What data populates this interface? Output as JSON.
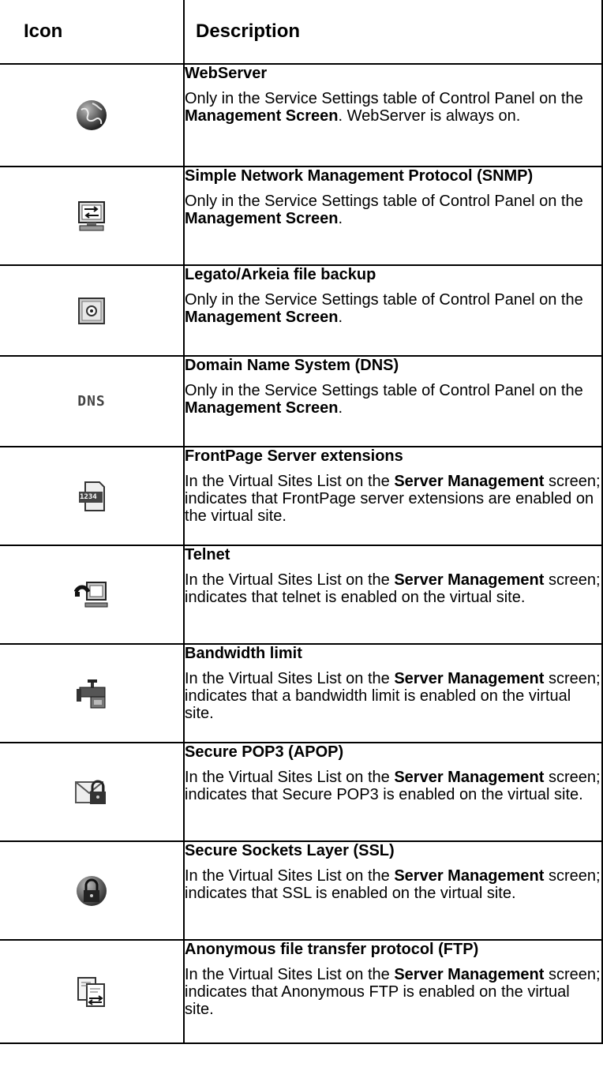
{
  "header": {
    "icon_col": "Icon",
    "desc_col": "Description"
  },
  "rows": [
    {
      "icon": "globe-icon",
      "title": "WebServer",
      "d1": "Only in the Service Settings table of Control Panel on the ",
      "b1": "Management Screen",
      "d2": ".  WebServer is always on.",
      "b2": "",
      "d3": ""
    },
    {
      "icon": "network-monitor-icon",
      "title": "Simple Network Management Protocol (SNMP)",
      "d1": "Only in the Service Settings table of Control Panel on the ",
      "b1": "Management Screen",
      "d2": ".",
      "b2": "",
      "d3": ""
    },
    {
      "icon": "safe-icon",
      "title": "Legato/Arkeia file backup",
      "d1": "Only in the Service Settings table of Control Panel on the ",
      "b1": "Management Screen",
      "d2": ".",
      "b2": "",
      "d3": ""
    },
    {
      "icon": "dns-icon",
      "icon_text": "DNS",
      "title": "Domain Name System (DNS)",
      "d1": "Only in the Service Settings table of Control Panel on the ",
      "b1": "Management Screen",
      "d2": ".",
      "b2": "",
      "d3": ""
    },
    {
      "icon": "frontpage-icon",
      "icon_text": "1234",
      "title": "FrontPage Server extensions",
      "d1": "In the Virtual Sites List on the ",
      "b1": "Server Management",
      "d2": " screen; indicates that FrontPage server extensions are enabled on the virtual site.",
      "b2": "",
      "d3": ""
    },
    {
      "icon": "telnet-icon",
      "title": "Telnet",
      "d1": "In the Virtual Sites List on the ",
      "b1": "Server Management",
      "d2": " screen; indicates that telnet is enabled on the virtual site.",
      "b2": "",
      "d3": ""
    },
    {
      "icon": "faucet-icon",
      "title": "Bandwidth limit",
      "d1": "In the Virtual Sites List on the ",
      "b1": "Server Management",
      "d2": " screen; indicates that a bandwidth limit is enabled on the virtual site.",
      "b2": "",
      "d3": ""
    },
    {
      "icon": "envelope-lock-icon",
      "title": "Secure POP3 (APOP)",
      "d1": "In the Virtual Sites List on the ",
      "b1": "Server Management",
      "d2": " screen; indicates that Secure POP3 is enabled on the virtual site.",
      "b2": "",
      "d3": ""
    },
    {
      "icon": "globe-lock-icon",
      "title": "Secure Sockets Layer (SSL)",
      "d1": "In the Virtual Sites List on the ",
      "b1": "Server Management",
      "d2": " screen; indicates that SSL is enabled on the virtual site.",
      "b2": "",
      "d3": ""
    },
    {
      "icon": "file-transfer-icon",
      "title": "Anonymous file transfer protocol (FTP)",
      "d1": "In the Virtual Sites List on the ",
      "b1": "Server Management",
      "d2": " screen; indicates that Anonymous FTP is enabled on the virtual site.",
      "b2": "",
      "d3": ""
    }
  ]
}
